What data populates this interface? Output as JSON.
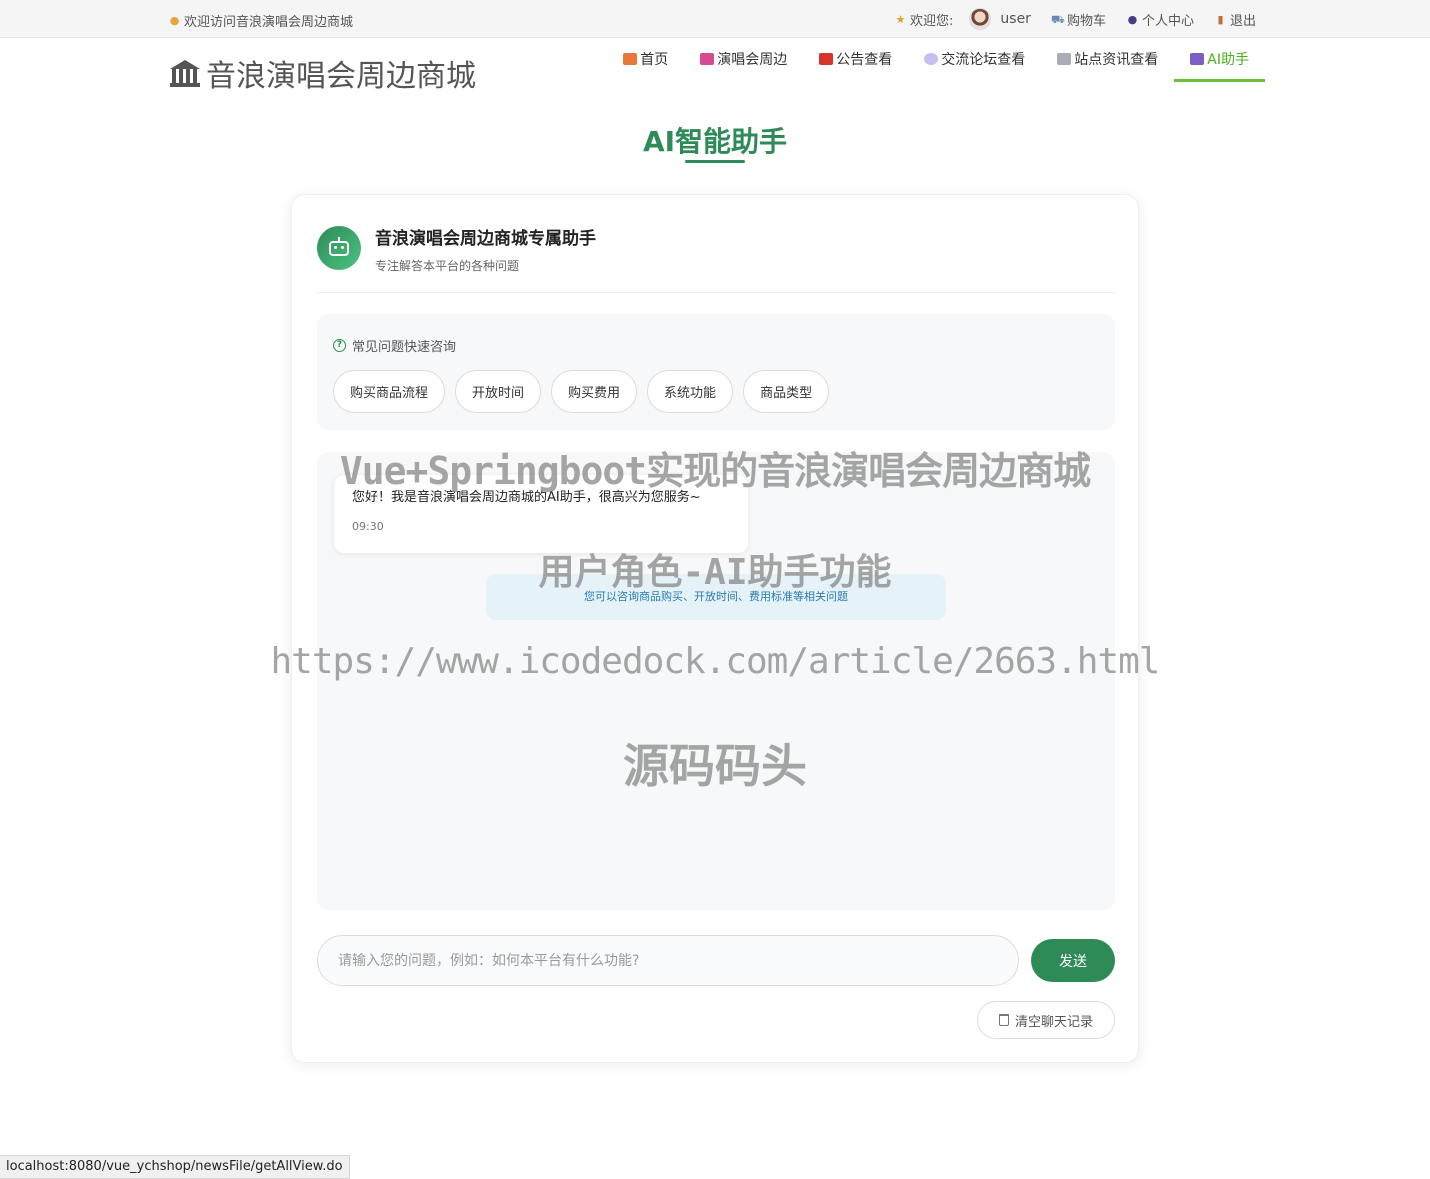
{
  "topbar": {
    "welcome": "欢迎访问音浪演唱会周边商城",
    "greeting": "欢迎您:",
    "username": "user",
    "cart": "购物车",
    "profile": "个人中心",
    "logout": "退出"
  },
  "header": {
    "logo": "音浪演唱会周边商城",
    "nav": [
      {
        "label": "首页",
        "icon": "home-icon",
        "color": "#e8783a"
      },
      {
        "label": "演唱会周边",
        "icon": "store-icon",
        "color": "#d64a8f"
      },
      {
        "label": "公告查看",
        "icon": "megaphone-icon",
        "color": "#d9342b"
      },
      {
        "label": "交流论坛查看",
        "icon": "speech-bubble-icon",
        "color": "#b8a6e6"
      },
      {
        "label": "站点资讯查看",
        "icon": "newspaper-icon",
        "color": "#8a8f99"
      },
      {
        "label": "AI助手",
        "icon": "robot-icon",
        "color": "#7a5fc4"
      }
    ]
  },
  "page": {
    "title": "AI智能助手"
  },
  "assistant": {
    "name": "音浪演唱会周边商城专属助手",
    "description": "专注解答本平台的各种问题"
  },
  "faq": {
    "title": "常见问题快速咨询",
    "items": [
      "购买商品流程",
      "开放时间",
      "购买费用",
      "系统功能",
      "商品类型"
    ]
  },
  "chat": {
    "messages": [
      {
        "text": "您好！我是音浪演唱会周边商城的AI助手，很高兴为您服务~",
        "time": "09:30"
      }
    ],
    "hint": "您可以咨询商品购买、开放时间、费用标准等相关问题"
  },
  "composer": {
    "placeholder": "请输入您的问题，例如：如何本平台有什么功能?",
    "send": "发送",
    "clear": "清空聊天记录"
  },
  "watermark": {
    "line1": "Vue+Springboot实现的音浪演唱会周边商城",
    "line2": "用户角色-AI助手功能",
    "line3": "https://www.icodedock.com/article/2663.html",
    "line4": "源码码头"
  },
  "statusbar": {
    "url": "localhost:8080/vue_ychshop/newsFile/getAllView.do"
  },
  "colors": {
    "accent": "#2e8b57",
    "nav_active": "#4caf1f"
  }
}
